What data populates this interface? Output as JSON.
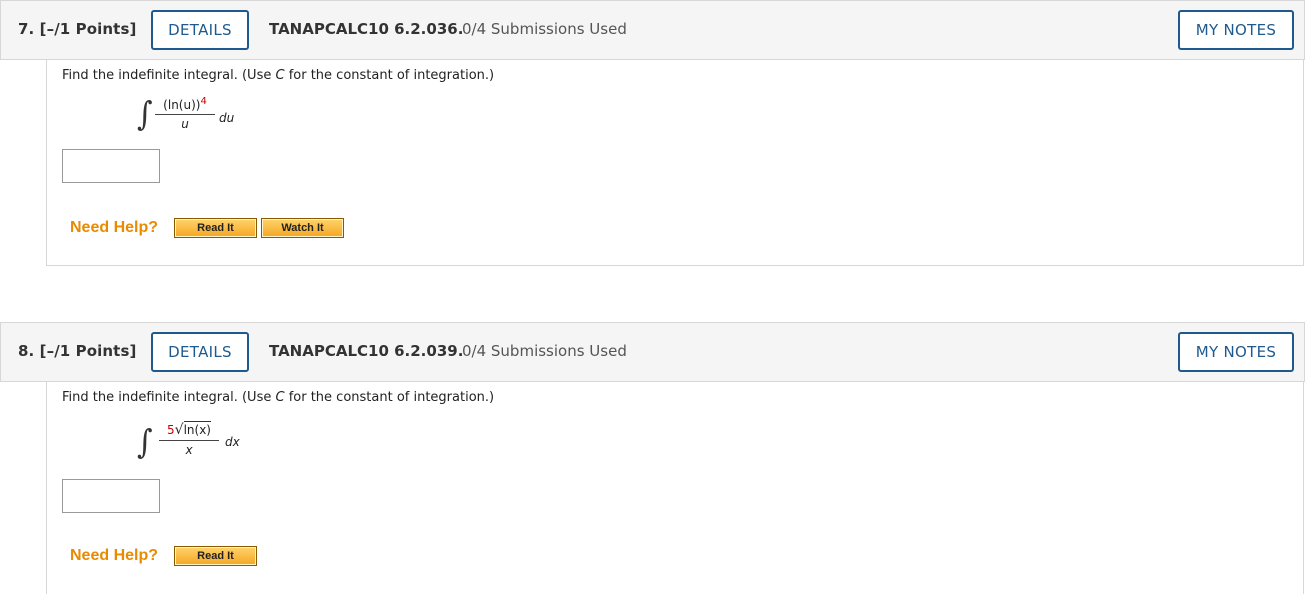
{
  "questions": [
    {
      "number_label": "7. [–/1 Points]",
      "details_label": "DETAILS",
      "code": "TANAPCALC10 6.2.036.",
      "submissions": "0/4 Submissions Used",
      "notes_label": "MY NOTES",
      "prompt_prefix": "Find the indefinite integral. (Use ",
      "prompt_var": "C",
      "prompt_suffix": " for the constant of integration.)",
      "integrand_numerator": "(ln(u))",
      "integrand_exponent": "4",
      "integrand_denominator": "u",
      "differential": "du",
      "answer_value": "",
      "need_help_label": "Need Help?",
      "help_buttons": [
        "Read It",
        "Watch It"
      ]
    },
    {
      "number_label": "8. [–/1 Points]",
      "details_label": "DETAILS",
      "code": "TANAPCALC10 6.2.039.",
      "submissions": "0/4 Submissions Used",
      "notes_label": "MY NOTES",
      "prompt_prefix": "Find the indefinite integral. (Use ",
      "prompt_var": "C",
      "prompt_suffix": " for the constant of integration.)",
      "root_index": "5",
      "radicand": "ln(x)",
      "integrand_denominator": "x",
      "differential": "dx",
      "answer_value": "",
      "need_help_label": "Need Help?",
      "help_buttons": [
        "Read It"
      ]
    }
  ],
  "colors": {
    "accent": "#1e5a8e",
    "need_help": "#e88b00",
    "highlight": "#cc0000",
    "header_bg": "#f5f5f5"
  }
}
